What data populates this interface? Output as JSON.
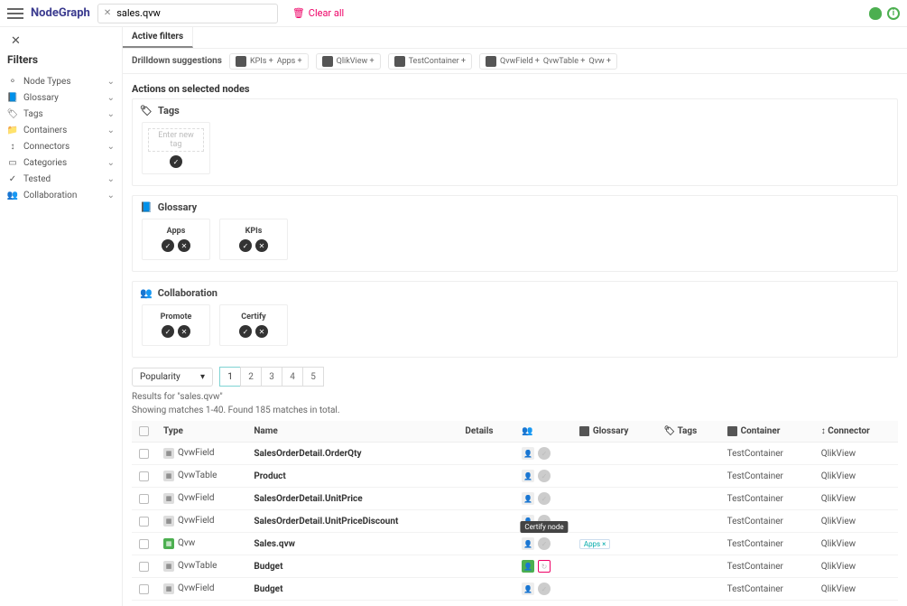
{
  "header": {
    "logo": "NodeGraph",
    "search_value": "sales.qvw",
    "clear_all": "Clear all"
  },
  "sidebar": {
    "title": "Filters",
    "items": [
      {
        "label": "Node Types"
      },
      {
        "label": "Glossary"
      },
      {
        "label": "Tags"
      },
      {
        "label": "Containers"
      },
      {
        "label": "Connectors"
      },
      {
        "label": "Categories"
      },
      {
        "label": "Tested"
      },
      {
        "label": "Collaboration"
      }
    ]
  },
  "tabs": {
    "active": "Active filters"
  },
  "drilldown": {
    "label": "Drilldown suggestions",
    "groups": [
      {
        "items": [
          "KPIs +",
          "Apps +"
        ]
      },
      {
        "items": [
          "QlikView +"
        ]
      },
      {
        "items": [
          "TestContainer +"
        ]
      },
      {
        "items": [
          "QvwField +",
          "QvwTable +",
          "Qvw +"
        ]
      }
    ]
  },
  "actions": {
    "title": "Actions on selected nodes",
    "tags": {
      "heading": "Tags",
      "placeholder": "Enter new tag"
    },
    "glossary": {
      "heading": "Glossary",
      "cards": [
        "Apps",
        "KPIs"
      ]
    },
    "collab": {
      "heading": "Collaboration",
      "cards": [
        "Promote",
        "Certify"
      ]
    }
  },
  "sort": {
    "value": "Popularity"
  },
  "pages": [
    "1",
    "2",
    "3",
    "4",
    "5"
  ],
  "results": {
    "line1": "Results for \"sales.qvw\"",
    "line2": "Showing matches 1-40. Found 185 matches in total."
  },
  "table": {
    "headers": {
      "type": "Type",
      "name": "Name",
      "details": "Details",
      "collab": "",
      "glossary": "Glossary",
      "tags": "Tags",
      "container": "Container",
      "connector": "Connector"
    },
    "rows": [
      {
        "type": "QvwField",
        "name": "SalesOrderDetail.OrderQty",
        "container": "TestContainer",
        "connector": "QlikView"
      },
      {
        "type": "QvwTable",
        "name": "Product",
        "container": "TestContainer",
        "connector": "QlikView"
      },
      {
        "type": "QvwField",
        "name": "SalesOrderDetail.UnitPrice",
        "container": "TestContainer",
        "connector": "QlikView"
      },
      {
        "type": "QvwField",
        "name": "SalesOrderDetail.UnitPriceDiscount",
        "container": "TestContainer",
        "connector": "QlikView"
      },
      {
        "type": "Qvw",
        "name": "Sales.qvw",
        "container": "TestContainer",
        "connector": "QlikView",
        "green": true,
        "tag": "Apps ×",
        "tooltip": "Certify node"
      },
      {
        "type": "QvwTable",
        "name": "Budget",
        "container": "TestContainer",
        "connector": "QlikView",
        "promote": true,
        "certify_hl": true
      },
      {
        "type": "QvwField",
        "name": "Budget",
        "container": "TestContainer",
        "connector": "QlikView"
      }
    ]
  }
}
